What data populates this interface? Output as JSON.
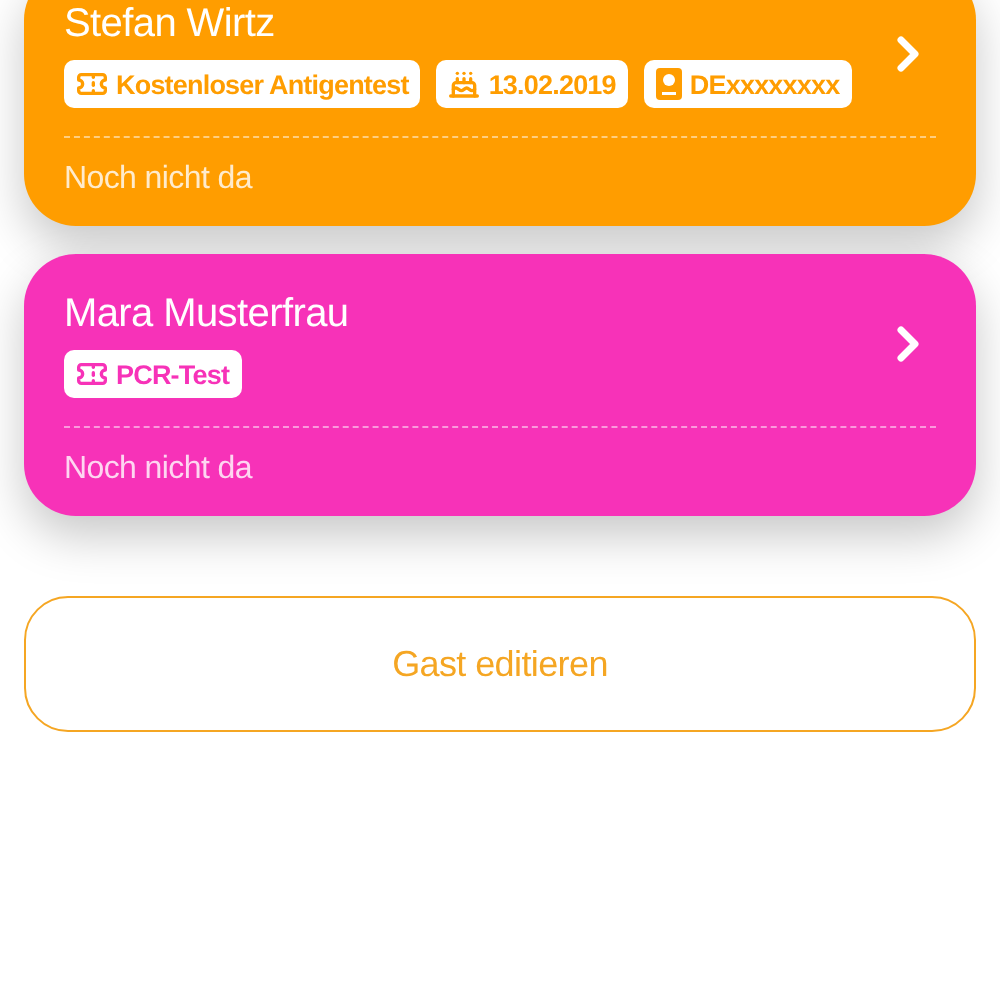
{
  "guests": [
    {
      "name": "Stefan Wirtz",
      "color": "#ff9d00",
      "tags": [
        {
          "kind": "test",
          "text": "Kostenloser Antigentest"
        },
        {
          "kind": "birthday",
          "text": "13.02.2019"
        },
        {
          "kind": "id",
          "text": "DExxxxxxxx"
        }
      ],
      "status": "Noch nicht da"
    },
    {
      "name": "Mara Musterfrau",
      "color": "#f732b8",
      "tags": [
        {
          "kind": "test",
          "text": "PCR-Test"
        }
      ],
      "status": "Noch nicht da"
    }
  ],
  "button": {
    "label": "Gast editieren"
  }
}
